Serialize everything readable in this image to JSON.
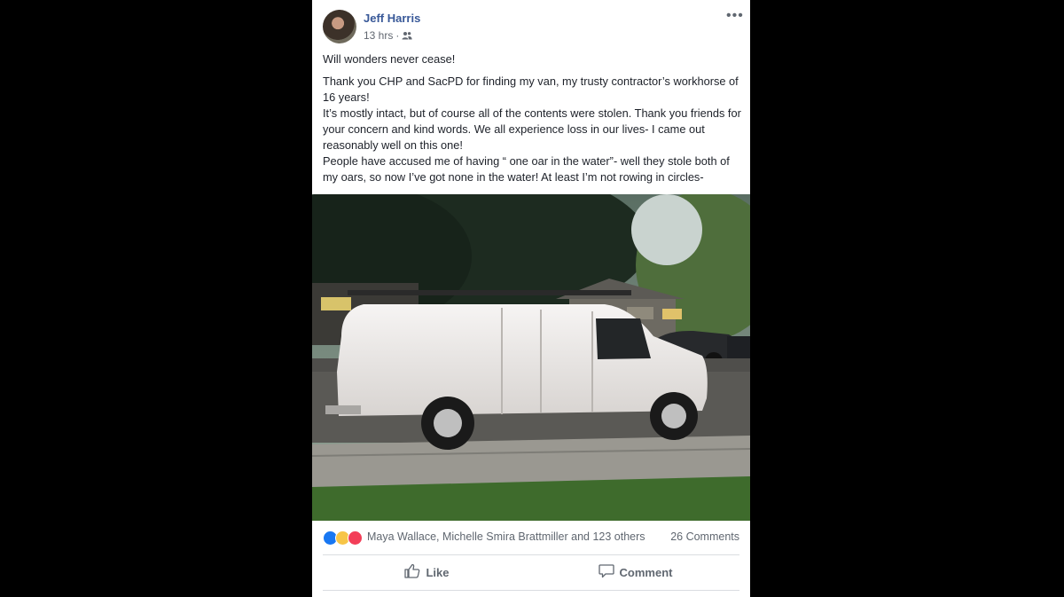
{
  "post": {
    "author": "Jeff Harris",
    "timestamp": "13 hrs",
    "separator": "·",
    "audience_icon": "friends-icon",
    "more_label": "•••",
    "paragraphs": [
      "Will wonders never cease!",
      "Thank you CHP and SacPD for finding my van, my trusty contractor’s workhorse of 16 years!",
      "It’s mostly intact, but of course all of the contents were stolen. Thank you friends for your concern and kind words. We all experience loss in our lives- I came out reasonably well on this one!",
      "People have accused me of having “ one oar in the water”- well they stole both of my oars, so now I’ve got none in the water! At least I’m not rowing in circles-"
    ]
  },
  "reactions": {
    "icons": [
      "like-reaction-icon",
      "wow-reaction-icon",
      "love-reaction-icon"
    ],
    "names": "Maya Wallace, Michelle Smira Brattmiller and 123 others",
    "comments": "26 Comments"
  },
  "actions": {
    "like_label": "Like",
    "comment_label": "Comment"
  },
  "colors": {
    "author": "#385898",
    "meta": "#616770",
    "text": "#1d2129",
    "backdrop": "#000000"
  }
}
